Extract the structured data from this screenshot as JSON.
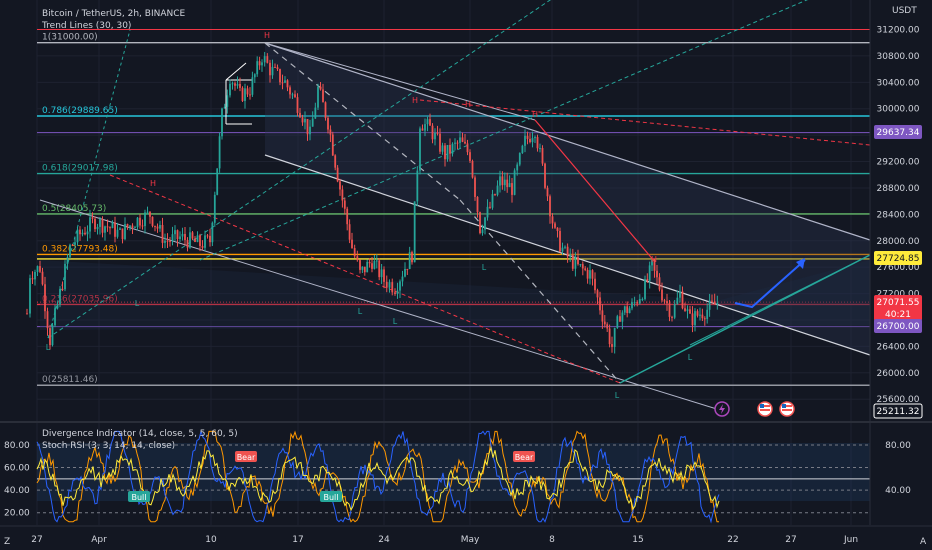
{
  "header": {
    "title": "Bitcoin / TetherUS, 2h, BINANCE",
    "indicator": "Trend Lines (30, 30)",
    "currency": "USDT"
  },
  "price_axis": {
    "ticks": [
      "31200.00",
      "30800.00",
      "30400.00",
      "30000.00",
      "29600.00",
      "29200.00",
      "28800.00",
      "28400.00",
      "28000.00",
      "27600.00",
      "27200.00",
      "26800.00",
      "26400.00",
      "26000.00",
      "25600.00"
    ]
  },
  "time_axis": {
    "ticks": [
      {
        "label": "27",
        "x": 37
      },
      {
        "label": "Apr",
        "x": 99
      },
      {
        "label": "10",
        "x": 211
      },
      {
        "label": "17",
        "x": 298
      },
      {
        "label": "24",
        "x": 384
      },
      {
        "label": "May",
        "x": 470
      },
      {
        "label": "8",
        "x": 552
      },
      {
        "label": "15",
        "x": 638
      },
      {
        "label": "22",
        "x": 733
      },
      {
        "label": "27",
        "x": 791
      },
      {
        "label": "Jun",
        "x": 851
      }
    ],
    "left_tool": "Z",
    "right_tool": "A"
  },
  "fib": [
    {
      "label": "1(31000.00)",
      "price": 31000,
      "color": "#b2b5be"
    },
    {
      "label": "0.786(29889.65)",
      "price": 29889.65,
      "color": "#26c6da"
    },
    {
      "label": "0.618(29017.98)",
      "price": 29017.98,
      "color": "#26a69a"
    },
    {
      "label": "0.5(28405.73)",
      "price": 28405.73,
      "color": "#66bb6a"
    },
    {
      "label": "0.382(27793.48)",
      "price": 27793.48,
      "color": "#ff9800"
    },
    {
      "label": "0.236(27035.96)",
      "price": 27035.96,
      "color": "#f23645"
    },
    {
      "label": "0(25811.46)",
      "price": 25811.46,
      "color": "#9598a1"
    }
  ],
  "badges": {
    "b1": {
      "text": "29637.34",
      "color": "#7e57c2"
    },
    "b2": {
      "text": "27724.85",
      "color": "#ffeb3b"
    },
    "b3": {
      "text": "27071.55",
      "color": "#f23645"
    },
    "b3b": {
      "text": "40:21",
      "color": "#f23645"
    },
    "b4": {
      "text": "26700.00",
      "color": "#7e57c2"
    },
    "b5": {
      "text": "25211.32",
      "color": "#131722"
    }
  },
  "pivots": {
    "high": "H",
    "low": "L"
  },
  "sub": {
    "indicator1": "Divergence Indicator (14, close, 5, 5, 60, 5)",
    "indicator2": "Stoch RSI (3, 3, 14, 14, close)",
    "ticks_left": [
      "80.00",
      "60.00",
      "40.00",
      "20.00"
    ],
    "ticks_right": [
      "80.00",
      "40.00"
    ],
    "bear_label": "Bear",
    "bull_label": "Bull"
  },
  "chart_data": {
    "type": "candlestick",
    "symbol": "Bitcoin / TetherUS",
    "interval": "2h",
    "exchange": "BINANCE",
    "current_price": 27071.55,
    "ylim": [
      25500,
      31400
    ],
    "ohlc_series": [
      [
        27,
        26900
      ],
      [
        30,
        27500
      ],
      [
        40,
        27600
      ],
      [
        50,
        26500
      ],
      [
        60,
        27200
      ],
      [
        70,
        27900
      ],
      [
        80,
        28100
      ],
      [
        95,
        28300
      ],
      [
        110,
        28200
      ],
      [
        120,
        28100
      ],
      [
        135,
        28300
      ],
      [
        150,
        28400
      ],
      [
        165,
        28000
      ],
      [
        180,
        28050
      ],
      [
        200,
        27950
      ],
      [
        210,
        28000
      ],
      [
        222,
        29900
      ],
      [
        230,
        30500
      ],
      [
        240,
        30200
      ],
      [
        250,
        30300
      ],
      [
        262,
        30800
      ],
      [
        270,
        30600
      ],
      [
        285,
        30400
      ],
      [
        300,
        30000
      ],
      [
        310,
        29600
      ],
      [
        318,
        30300
      ],
      [
        328,
        29800
      ],
      [
        340,
        28800
      ],
      [
        352,
        27900
      ],
      [
        360,
        27500
      ],
      [
        372,
        27700
      ],
      [
        384,
        27400
      ],
      [
        395,
        27300
      ],
      [
        405,
        27600
      ],
      [
        412,
        27800
      ],
      [
        420,
        29800
      ],
      [
        430,
        29700
      ],
      [
        445,
        29300
      ],
      [
        460,
        29500
      ],
      [
        470,
        29300
      ],
      [
        480,
        28200
      ],
      [
        490,
        28500
      ],
      [
        500,
        28900
      ],
      [
        512,
        28800
      ],
      [
        525,
        29500
      ],
      [
        535,
        29700
      ],
      [
        545,
        28900
      ],
      [
        555,
        28100
      ],
      [
        565,
        27800
      ],
      [
        578,
        27600
      ],
      [
        590,
        27500
      ],
      [
        600,
        27000
      ],
      [
        612,
        26400
      ],
      [
        620,
        26900
      ],
      [
        632,
        27000
      ],
      [
        645,
        27300
      ],
      [
        652,
        27600
      ],
      [
        662,
        27200
      ],
      [
        672,
        26900
      ],
      [
        680,
        27200
      ],
      [
        690,
        26800
      ],
      [
        700,
        26900
      ],
      [
        712,
        27000
      ],
      [
        720,
        27100
      ]
    ],
    "subpanel": {
      "indicators": [
        "Divergence Indicator (14, close, 5, 5, 60, 5)",
        "Stoch RSI (3, 3, 14, 14, close)"
      ],
      "ylim": [
        10,
        95
      ],
      "bear_at": [
        245,
        523
      ],
      "bull_at": [
        138,
        330
      ]
    }
  }
}
